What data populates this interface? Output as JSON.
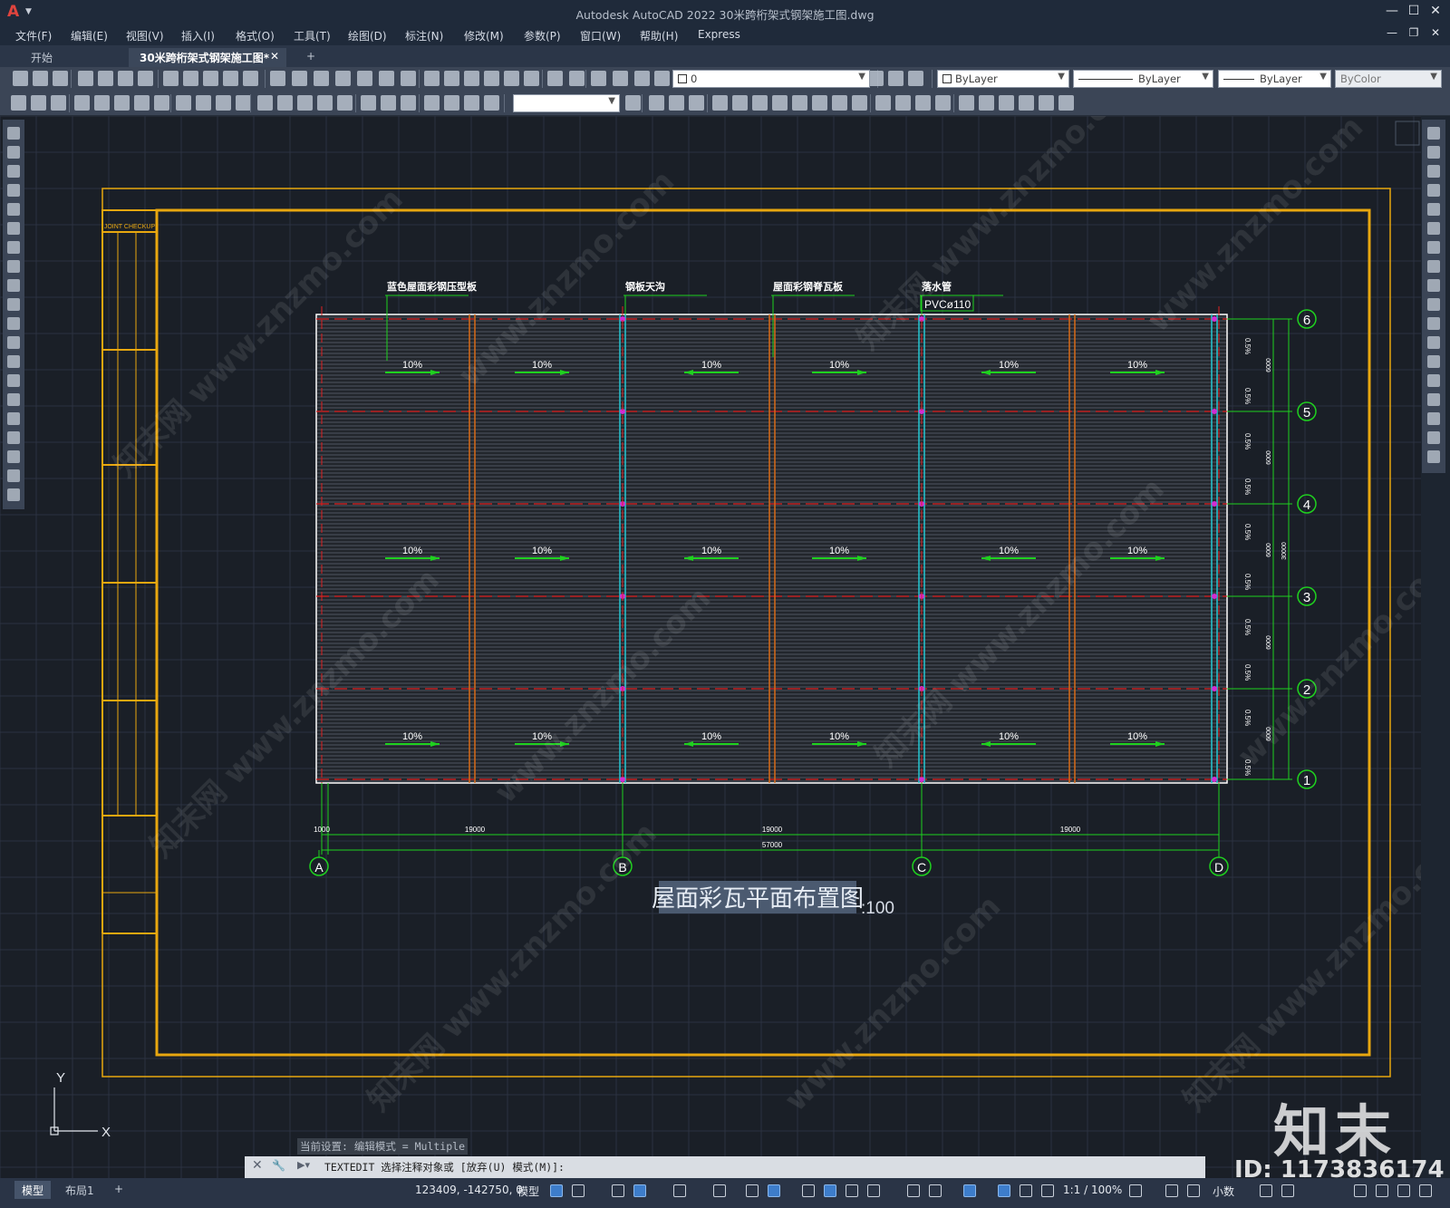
{
  "window": {
    "app_logo": "A",
    "title": "Autodesk AutoCAD 2022    30米跨桁架式钢架施工图.dwg",
    "controls": [
      "—",
      "☐",
      "✕"
    ],
    "doc_controls": [
      "—",
      "❐",
      "✕"
    ]
  },
  "menu": [
    "文件(F)",
    "编辑(E)",
    "视图(V)",
    "插入(I)",
    "格式(O)",
    "工具(T)",
    "绘图(D)",
    "标注(N)",
    "修改(M)",
    "参数(P)",
    "窗口(W)",
    "帮助(H)",
    "Express"
  ],
  "tabs": {
    "start": "开始",
    "active": "30米跨桁架式钢架施工图*",
    "close": "✕",
    "add": "+"
  },
  "toolbar": {
    "layer_value": "0",
    "color_value": "ByLayer",
    "linetype_value": "ByLayer",
    "lineweight_value": "ByLayer",
    "plotstyle_value": "ByColor"
  },
  "drawing": {
    "callouts": [
      "蓝色屋面彩钢压型板",
      "钢板天沟",
      "屋面彩钢脊瓦板",
      "落水管",
      "PVCø110"
    ],
    "slope_label": "10%",
    "side_slope_label": "0.5%",
    "grid_rows": [
      "6",
      "5",
      "4",
      "3",
      "2",
      "1"
    ],
    "grid_cols": [
      "A",
      "B",
      "C",
      "D"
    ],
    "dim_bays": [
      "19000",
      "19000",
      "19000"
    ],
    "dim_total": "57000",
    "dim_edge": "1000",
    "dim_rows": [
      "6000",
      "6000",
      "6000",
      "6000",
      "6000"
    ],
    "dim_rows_total": "30000",
    "plan_title": "屋面彩瓦平面布置图",
    "plan_scale": ":100",
    "title_block_header": "JOINT CHECKUP",
    "ucs_y": "Y",
    "ucs_x": "X"
  },
  "command": {
    "history": "当前设置: 编辑模式 = Multiple",
    "prompt": "TEXTEDIT 选择注释对象或 [放弃(U) 模式(M)]:"
  },
  "status": {
    "layout_tabs": [
      "模型",
      "布局1"
    ],
    "add_layout": "+",
    "coords": "123409, -142750, 0",
    "space": "模型",
    "scale": "1:1 / 100%",
    "units": "小数"
  },
  "watermark": {
    "logo": "知末",
    "id": "ID: 1173836174",
    "url_text": "www.znzmo.com",
    "brand_text": "知末网"
  },
  "colors": {
    "canvas": "#1a1f27",
    "grid": "#2b3240",
    "frame": "#e8a70f",
    "dim": "#1fd11f",
    "axis_red": "#e02020",
    "cyan": "#25c6d2",
    "orange": "#d86a16",
    "magenta": "#d22cd2"
  }
}
